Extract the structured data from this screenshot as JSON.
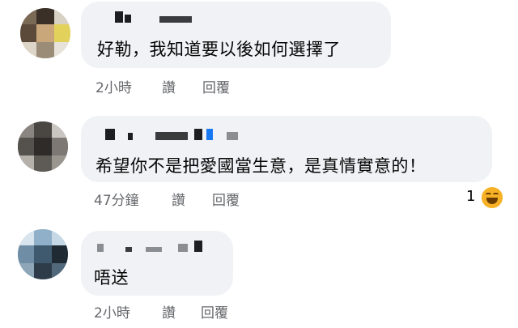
{
  "comments": [
    {
      "text": "好勒，我知道要以後如何選擇了",
      "time": "2小時",
      "like_label": "讚",
      "reply_label": "回覆"
    },
    {
      "text": "希望你不是把愛國當生意，是真情實意的！",
      "time": "47分鐘",
      "like_label": "讚",
      "reply_label": "回覆",
      "reaction_count": "1",
      "reaction_icon": "haha-emoji-icon"
    },
    {
      "text": "唔送",
      "time": "2小時",
      "like_label": "讚",
      "reply_label": "回覆"
    }
  ],
  "colors": {
    "bubble": "#f0f2f5",
    "text": "#050505",
    "meta": "#65676b"
  }
}
